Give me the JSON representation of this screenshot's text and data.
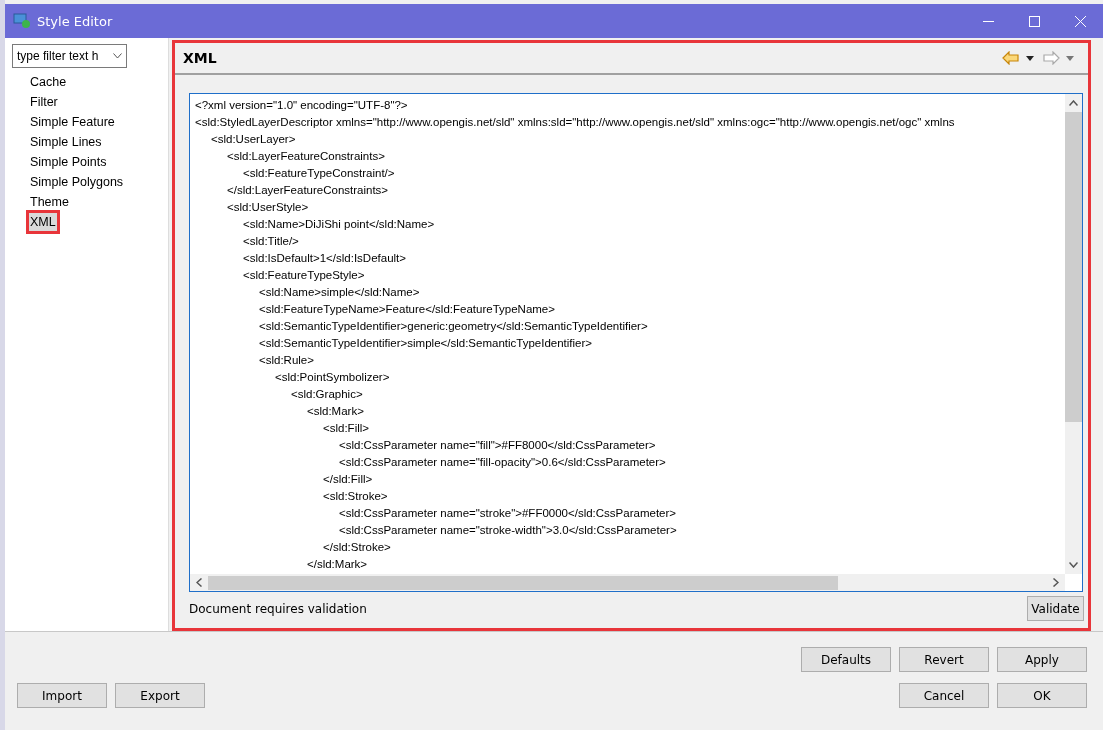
{
  "window": {
    "title": "Style Editor"
  },
  "filter": {
    "value": "type filter text h"
  },
  "sidebar": {
    "items": [
      {
        "label": "Cache",
        "selected": false
      },
      {
        "label": "Filter",
        "selected": false
      },
      {
        "label": "Simple Feature",
        "selected": false
      },
      {
        "label": "Simple Lines",
        "selected": false
      },
      {
        "label": "Simple Points",
        "selected": false
      },
      {
        "label": "Simple Polygons",
        "selected": false
      },
      {
        "label": "Theme",
        "selected": false
      },
      {
        "label": "XML",
        "selected": true
      }
    ]
  },
  "page": {
    "title": "XML",
    "editor_lines": [
      "<?xml version=\"1.0\" encoding=\"UTF-8\"?>",
      "<sld:StyledLayerDescriptor xmlns=\"http://www.opengis.net/sld\" xmlns:sld=\"http://www.opengis.net/sld\" xmlns:ogc=\"http://www.opengis.net/ogc\" xmlns",
      "\t<sld:UserLayer>",
      "\t\t<sld:LayerFeatureConstraints>",
      "\t\t\t<sld:FeatureTypeConstraint/>",
      "\t\t</sld:LayerFeatureConstraints>",
      "\t\t<sld:UserStyle>",
      "\t\t\t<sld:Name>DiJiShi point</sld:Name>",
      "\t\t\t<sld:Title/>",
      "\t\t\t<sld:IsDefault>1</sld:IsDefault>",
      "\t\t\t<sld:FeatureTypeStyle>",
      "\t\t\t\t<sld:Name>simple</sld:Name>",
      "\t\t\t\t<sld:FeatureTypeName>Feature</sld:FeatureTypeName>",
      "\t\t\t\t<sld:SemanticTypeIdentifier>generic:geometry</sld:SemanticTypeIdentifier>",
      "\t\t\t\t<sld:SemanticTypeIdentifier>simple</sld:SemanticTypeIdentifier>",
      "\t\t\t\t<sld:Rule>",
      "\t\t\t\t\t<sld:PointSymbolizer>",
      "\t\t\t\t\t\t<sld:Graphic>",
      "\t\t\t\t\t\t\t<sld:Mark>",
      "\t\t\t\t\t\t\t\t<sld:Fill>",
      "\t\t\t\t\t\t\t\t\t<sld:CssParameter name=\"fill\">#FF8000</sld:CssParameter>",
      "\t\t\t\t\t\t\t\t\t<sld:CssParameter name=\"fill-opacity\">0.6</sld:CssParameter>",
      "\t\t\t\t\t\t\t\t</sld:Fill>",
      "\t\t\t\t\t\t\t\t<sld:Stroke>",
      "\t\t\t\t\t\t\t\t\t<sld:CssParameter name=\"stroke\">#FF0000</sld:CssParameter>",
      "\t\t\t\t\t\t\t\t\t<sld:CssParameter name=\"stroke-width\">3.0</sld:CssParameter>",
      "\t\t\t\t\t\t\t\t</sld:Stroke>",
      "\t\t\t\t\t\t\t</sld:Mark>"
    ],
    "status": "Document requires validation",
    "validate_button": "Validate"
  },
  "buttons_top": [
    "Defaults",
    "Revert",
    "Apply"
  ],
  "buttons_left": [
    "Import",
    "Export"
  ],
  "buttons_right": [
    "Cancel",
    "OK"
  ]
}
